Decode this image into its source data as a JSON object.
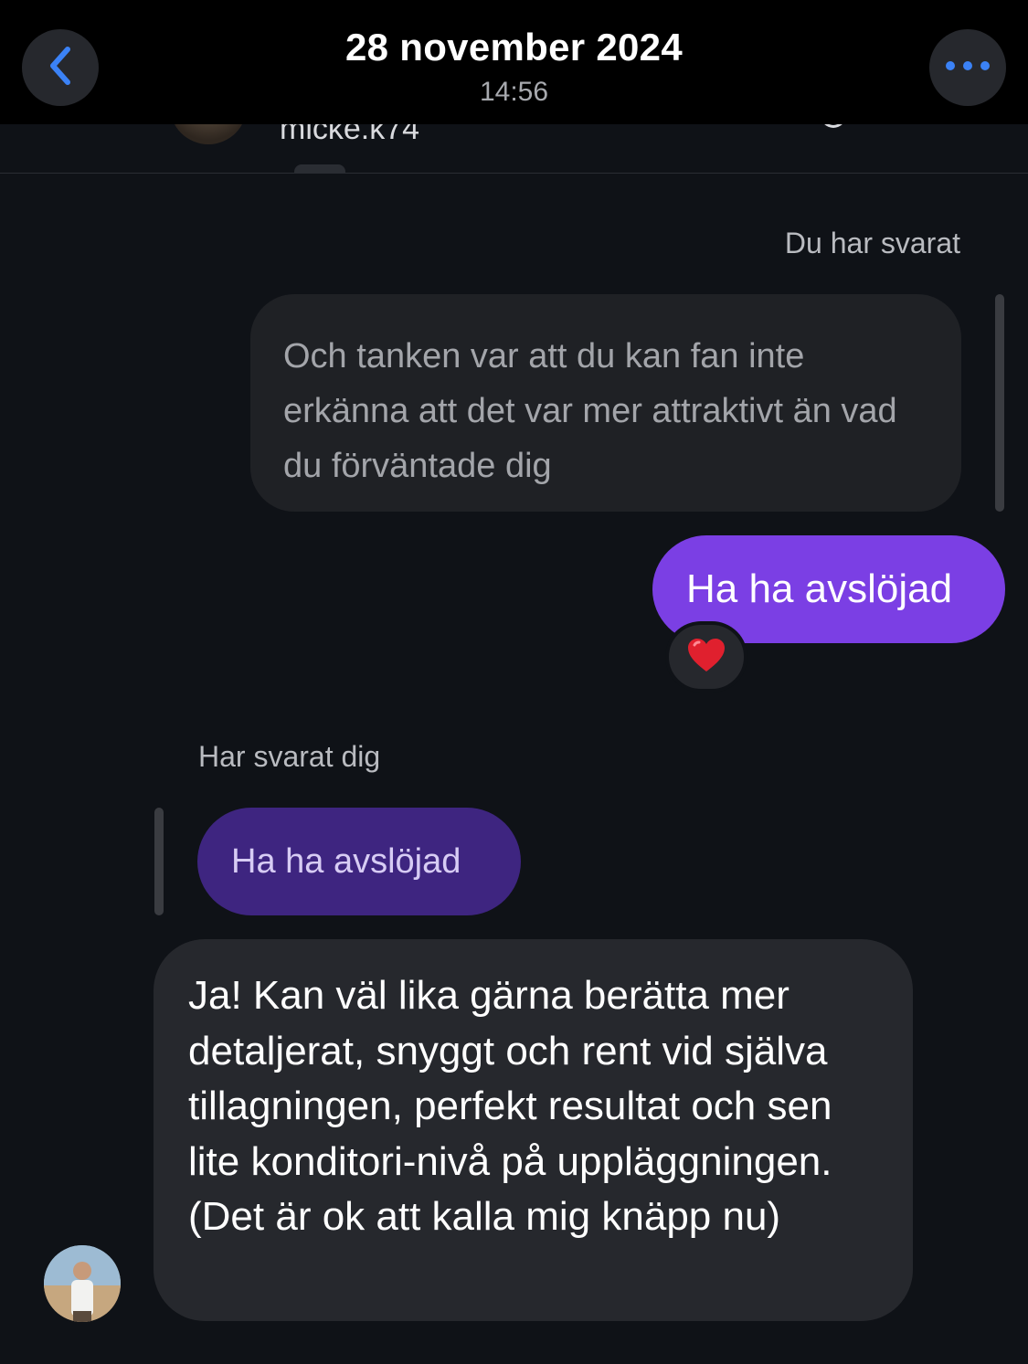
{
  "header": {
    "date": "28 november 2024",
    "time": "14:56",
    "back_icon": "chevron-left-icon",
    "more_icon": "ellipsis-icon",
    "accent_color": "#3b82f6"
  },
  "profile": {
    "username": "micke.k74"
  },
  "thread": {
    "sent_reply_label": "Du har svarat",
    "quoted_message": "Och tanken var att du kan fan inte erkänna att det var mer attraktivt än vad du förväntade dig",
    "sent_message": "Ha ha avslöjad",
    "reaction": "❤️",
    "received_reply_label": "Har svarat dig",
    "received_quote": "Ha ha avslöjad",
    "received_message": "Ja! Kan väl lika gärna berätta mer detaljerat, snyggt och rent vid själva tillagningen, perfekt resultat och sen lite konditori-nivå på uppläggningen. (Det är ok att kalla mig knäpp nu)"
  },
  "colors": {
    "sent_bubble": "#7b3fe4",
    "received_bubble": "#26282d",
    "background": "#0f1217"
  }
}
